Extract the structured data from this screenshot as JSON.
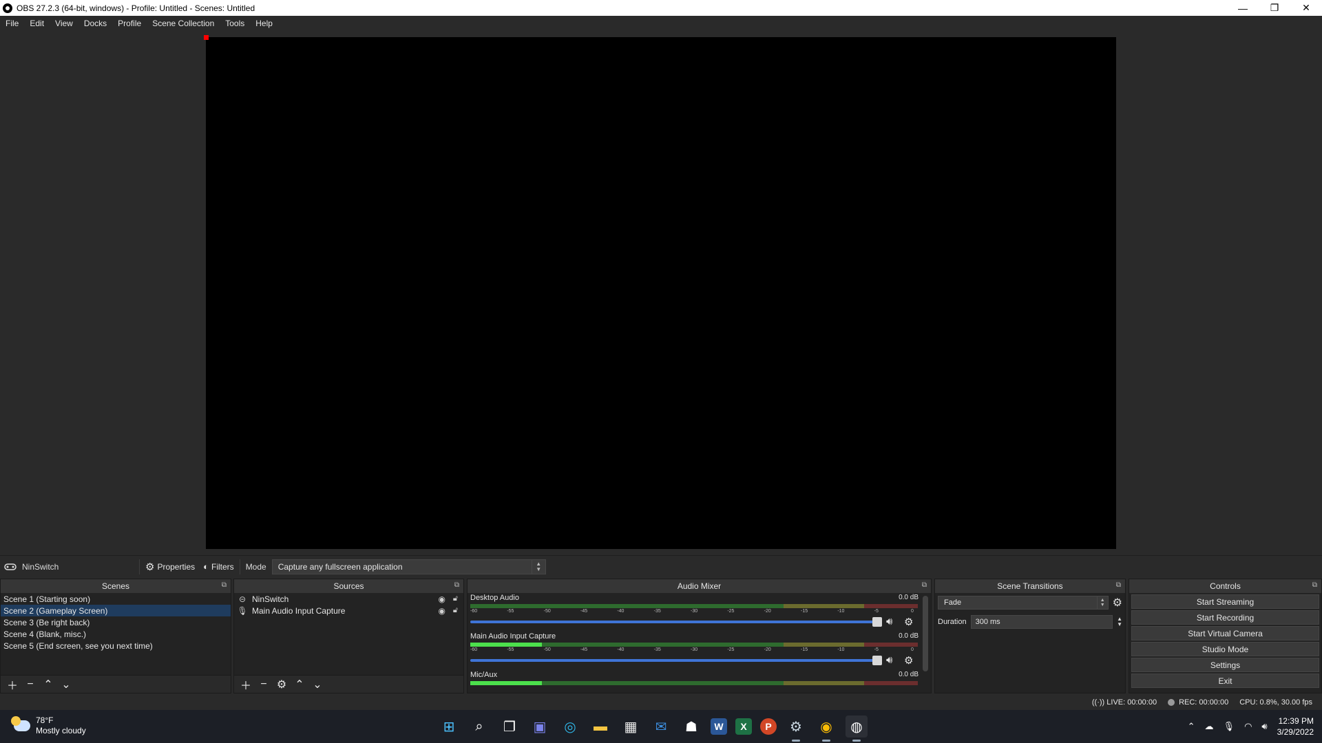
{
  "window": {
    "title": "OBS 27.2.3 (64-bit, windows) - Profile: Untitled - Scenes: Untitled",
    "minimize": "—",
    "restore": "❐",
    "close": "✕"
  },
  "menu": [
    "File",
    "Edit",
    "View",
    "Docks",
    "Profile",
    "Scene Collection",
    "Tools",
    "Help"
  ],
  "source_toolbar": {
    "source_name": "NinSwitch",
    "properties_label": "Properties",
    "filters_label": "Filters",
    "mode_label": "Mode",
    "mode_value": "Capture any fullscreen application"
  },
  "scenes": {
    "title": "Scenes",
    "items": [
      "Scene 1 (Starting soon)",
      "Scene 2 (Gameplay Screen)",
      "Scene 3 (Be right back)",
      "Scene 4 (Blank, misc.)",
      "Scene 5 (End screen, see you next time)"
    ],
    "selected_index": 1
  },
  "sources": {
    "title": "Sources",
    "items": [
      {
        "name": "NinSwitch",
        "icon": "gamepad-icon"
      },
      {
        "name": "Main Audio Input Capture",
        "icon": "microphone-icon"
      }
    ]
  },
  "mixer": {
    "title": "Audio Mixer",
    "ticks": [
      "-60",
      "-55",
      "-50",
      "-45",
      "-40",
      "-35",
      "-30",
      "-25",
      "-20",
      "-15",
      "-10",
      "-5",
      "0"
    ],
    "channels": [
      {
        "name": "Desktop Audio",
        "db": "0.0 dB",
        "level": 0.0
      },
      {
        "name": "Main Audio Input Capture",
        "db": "0.0 dB",
        "level": 0.16
      },
      {
        "name": "Mic/Aux",
        "db": "0.0 dB",
        "level": 0.16
      }
    ]
  },
  "transitions": {
    "title": "Scene Transitions",
    "type": "Fade",
    "duration_label": "Duration",
    "duration_value": "300 ms"
  },
  "controls": {
    "title": "Controls",
    "buttons": [
      "Start Streaming",
      "Start Recording",
      "Start Virtual Camera",
      "Studio Mode",
      "Settings",
      "Exit"
    ]
  },
  "status": {
    "live": "LIVE: 00:00:00",
    "rec": "REC: 00:00:00",
    "cpu": "CPU: 0.8%, 30.00 fps"
  },
  "taskbar": {
    "temperature": "78°F",
    "condition": "Mostly cloudy",
    "time": "12:39 PM",
    "date": "3/29/2022"
  }
}
